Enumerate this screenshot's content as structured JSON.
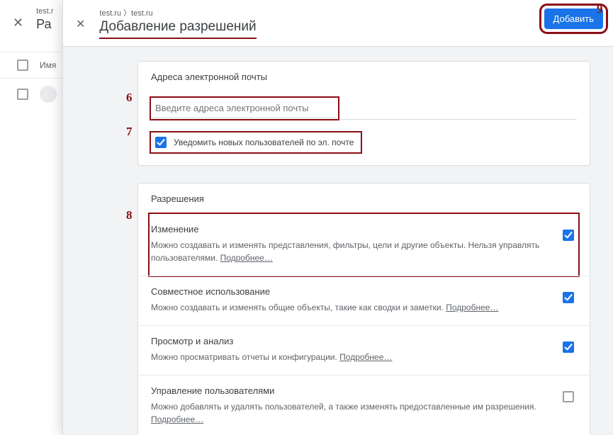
{
  "background": {
    "breadcrumb": "test.r",
    "title": "Ра",
    "column_label": "Имя"
  },
  "modal": {
    "breadcrumb": "test.ru 〉test.ru",
    "title": "Добавление разрешений",
    "add_button": "Добавить"
  },
  "email_card": {
    "section_title": "Адреса электронной почты",
    "placeholder": "Введите адреса электронной почты",
    "notify_label": "Уведомить новых пользователей по эл. почте"
  },
  "permissions_card": {
    "section_title": "Разрешения",
    "items": [
      {
        "title": "Изменение",
        "desc_a": "Можно создавать и изменять представления, фильтры, цели и другие объекты. Нельзя управлять пользователями. ",
        "link": "Подробнее…",
        "checked": true,
        "highlighted": true
      },
      {
        "title": "Совместное использование",
        "desc_a": "Можно создавать и изменять общие объекты, такие как сводки и заметки. ",
        "link": "Подробнее…",
        "checked": true,
        "highlighted": false
      },
      {
        "title": "Просмотр и анализ",
        "desc_a": "Можно просматривать отчеты и конфигурации. ",
        "link": "Подробнее…",
        "checked": true,
        "highlighted": false
      },
      {
        "title": "Управление пользователями",
        "desc_a": "Можно добавлять и удалять пользователей, а также изменять предоставленные им разрешения. ",
        "link": "Подробнее…",
        "checked": false,
        "highlighted": false
      }
    ]
  },
  "annotations": {
    "n6": "6",
    "n7": "7",
    "n8": "8",
    "n9": "9"
  }
}
